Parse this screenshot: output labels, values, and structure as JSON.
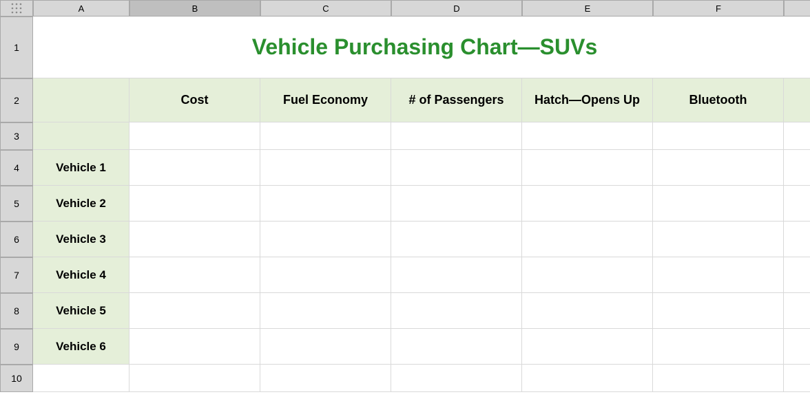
{
  "columns": [
    "A",
    "B",
    "C",
    "D",
    "E",
    "F"
  ],
  "rows": [
    "1",
    "2",
    "3",
    "4",
    "5",
    "6",
    "7",
    "8",
    "9",
    "10"
  ],
  "title": "Vehicle Purchasing Chart—SUVs",
  "headers": {
    "cost": "Cost",
    "fuel": "Fuel Economy",
    "passengers": "# of Passengers",
    "hatch": "Hatch—Opens Up",
    "bluetooth": "Bluetooth"
  },
  "vehicles": [
    "Vehicle 1",
    "Vehicle 2",
    "Vehicle 3",
    "Vehicle 4",
    "Vehicle 5",
    "Vehicle 6"
  ],
  "selected_column": "B"
}
